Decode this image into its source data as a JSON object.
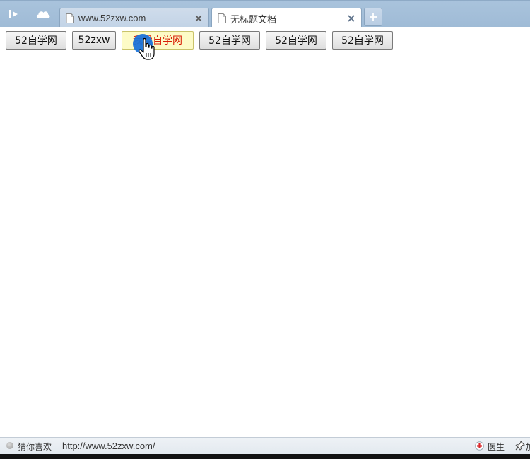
{
  "browser": {
    "tabs": [
      {
        "title": "www.52zxw.com",
        "active": false
      },
      {
        "title": "无标题文档",
        "active": true
      }
    ],
    "icons": {
      "sidebar": "sidebar-toggle-icon",
      "cloud": "cloud-icon",
      "page": "page-icon",
      "close": "close-icon",
      "new_tab": "plus-icon"
    }
  },
  "page": {
    "buttons": [
      {
        "label": "52自学网"
      },
      {
        "label": "52zxw"
      },
      {
        "label": "我爱自学网",
        "state": "hover"
      },
      {
        "label": "52自学网"
      },
      {
        "label": "52自学网"
      },
      {
        "label": "52自学网"
      }
    ],
    "hover_text_color": "#d81e06",
    "hover_bg_color": "#fdfbc6"
  },
  "statusbar": {
    "guess_label": "猜你喜欢",
    "url": "http://www.52zxw.com/",
    "doctor_label": "医生",
    "trailing_label": "加"
  }
}
